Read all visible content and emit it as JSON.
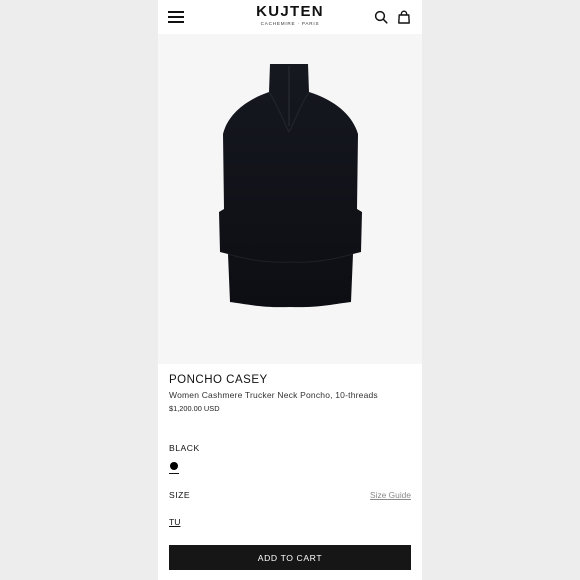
{
  "header": {
    "logo_text": "KUJTEN",
    "logo_subtitle": "CACHEMIRE · PARIS",
    "menu_icon": "hamburger-menu-icon",
    "search_icon": "search-icon",
    "bag_icon": "shopping-bag-icon"
  },
  "product": {
    "image_alt": "black poncho with zip trucker neck",
    "title": "PONCHO CASEY",
    "subtitle": "Women Cashmere Trucker Neck Poncho, 10-threads",
    "price": "$1,200.00 USD",
    "color_label": "BLACK",
    "color_swatch": "#000000",
    "size_label": "SIZE",
    "size_guide_label": "Size Guide",
    "selected_size": "TU",
    "add_to_cart_label": "ADD TO CART"
  },
  "colors": {
    "background": "#ededed",
    "card": "#ffffff",
    "image_bg": "#f6f6f6",
    "button_bg": "#161616",
    "button_text": "#ffffff",
    "muted_text": "#8a8a8a"
  }
}
